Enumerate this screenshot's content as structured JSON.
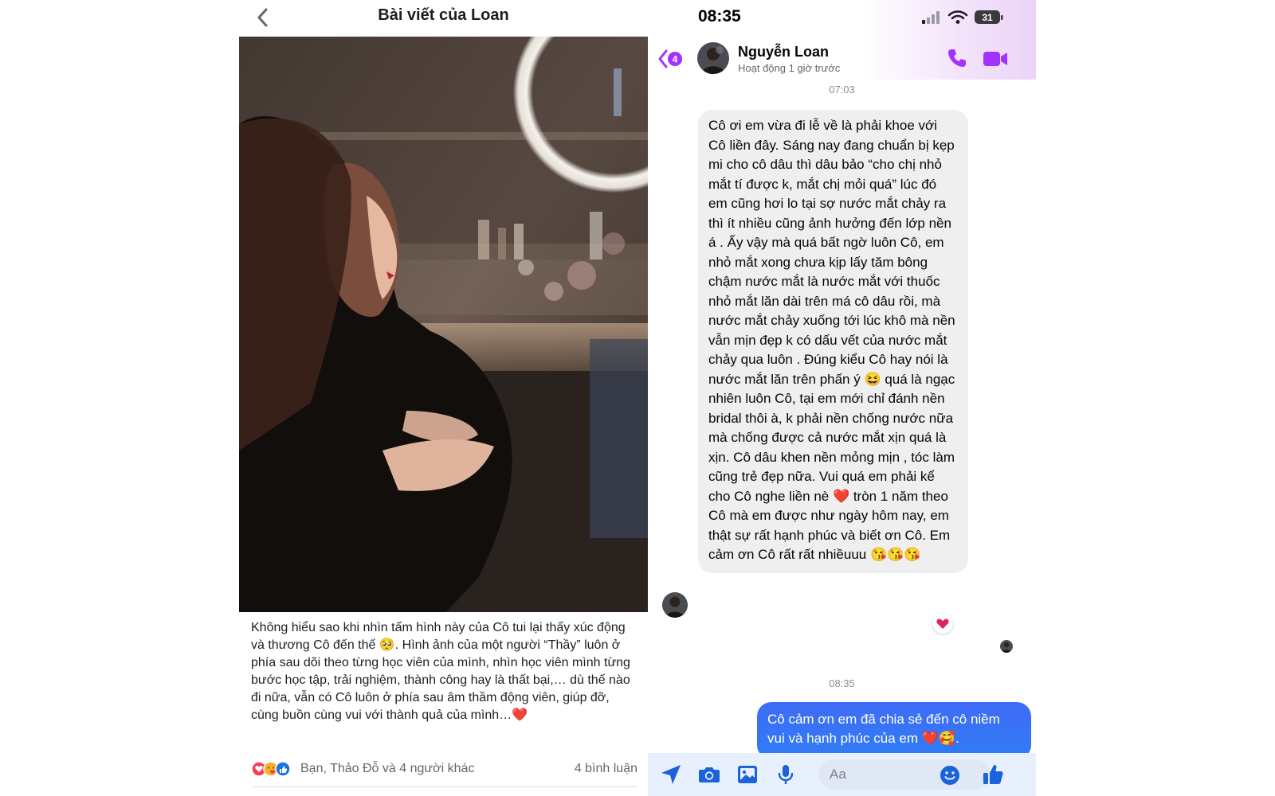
{
  "facebook_post": {
    "title": "Bài viết của Loan",
    "caption": "Không hiểu sao khi nhìn tấm hình này của Cô tui lại thấy xúc động và thương Cô đến thế 🥺. Hình ảnh của một người “Thầy” luôn ở phía sau dõi theo từng học viên của mình, nhìn học viên mình từng bước học tập, trải nghiệm, thành công hay là thất bại,… dù thế nào đi nữa, vẫn có Cô luôn ở phía sau âm thầm động viên, giúp đỡ, cùng buồn cùng vui với thành quả của mình…❤️",
    "reactions_text": "Bạn, Thảo Đỗ và 4 người khác",
    "comments_text": "4 bình luận",
    "reaction_icons": [
      "heart-reaction",
      "care-reaction",
      "like-reaction"
    ]
  },
  "messenger": {
    "status_time": "08:35",
    "battery": "31",
    "back_badge": "4",
    "contact_name": "Nguyễn Loan",
    "contact_status": "Hoạt động 1 giờ trước",
    "timestamp_1": "07:03",
    "incoming_message": "Cô ơi em vừa đi lễ về là phải khoe với Cô liền đây. Sáng nay đang chuẩn bị kẹp mi cho cô dâu thì dâu bảo “cho chị nhỏ mắt tí được k, mắt chị mỏi quá” lúc đó em cũng hơi lo tại sợ nước mắt chảy ra thì ít nhiều cũng ảnh hưởng đến lớp nền á . Ấy vậy mà quá bất ngờ luôn Cô, em nhỏ mắt xong chưa kịp lấy tăm bông chậm nước mắt là nước mắt với thuốc nhỏ mắt lăn dài trên má cô dâu rồi, mà nước mắt chảy xuống tới lúc khô mà nền vẫn mịn đẹp k có dấu vết của nước mắt chảy qua luôn . Đúng kiểu Cô hay nói là nước mắt lăn trên phấn ý 😆 quá là ngạc nhiên luôn Cô, tại em mới chỉ đánh nền bridal thôi à, k phải nền chống nước nữa mà chống được cả nước mắt xịn quá là xịn. Cô dâu khen nền mỏng mịn , tóc làm cũng trẻ đẹp nữa. Vui quá em phải kể cho Cô nghe liền nè ❤️ tròn 1 năm theo Cô mà em được như ngày hôm nay, em thật sự rất hạnh phúc và biết ơn Cô. Em cảm ơn Cô rất rất nhiềuuu 😘😘😘",
    "message_reaction": "❤️",
    "timestamp_2": "08:35",
    "outgoing_message": "Cô cảm ơn em đã chia sẻ đến cô niềm vui và hạnh phúc của em ❤️🥰.",
    "input_placeholder": "Aa",
    "accent_color": "#a033ff",
    "outgoing_color": "#2f6ef5"
  }
}
